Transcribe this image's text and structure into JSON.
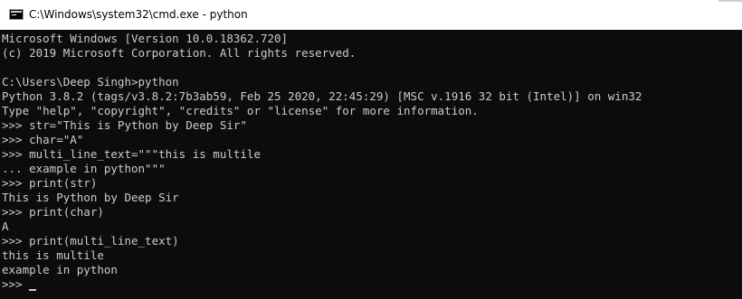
{
  "window": {
    "title": "C:\\Windows\\system32\\cmd.exe - python",
    "icon": "cmd-console-icon"
  },
  "console": {
    "lines": [
      "Microsoft Windows [Version 10.0.18362.720]",
      "(c) 2019 Microsoft Corporation. All rights reserved.",
      "",
      "C:\\Users\\Deep Singh>python",
      "Python 3.8.2 (tags/v3.8.2:7b3ab59, Feb 25 2020, 22:45:29) [MSC v.1916 32 bit (Intel)] on win32",
      "Type \"help\", \"copyright\", \"credits\" or \"license\" for more information.",
      ">>> str=\"This is Python by Deep Sir\"",
      ">>> char=\"A\"",
      ">>> multi_line_text=\"\"\"this is multile",
      "... example in python\"\"\"",
      ">>> print(str)",
      "This is Python by Deep Sir",
      ">>> print(char)",
      "A",
      ">>> print(multi_line_text)",
      "this is multile",
      "example in python"
    ],
    "prompt": ">>> "
  },
  "colors": {
    "console_background": "#0c0c0c",
    "console_text": "#cccccc",
    "titlebar_background": "#ffffff"
  }
}
